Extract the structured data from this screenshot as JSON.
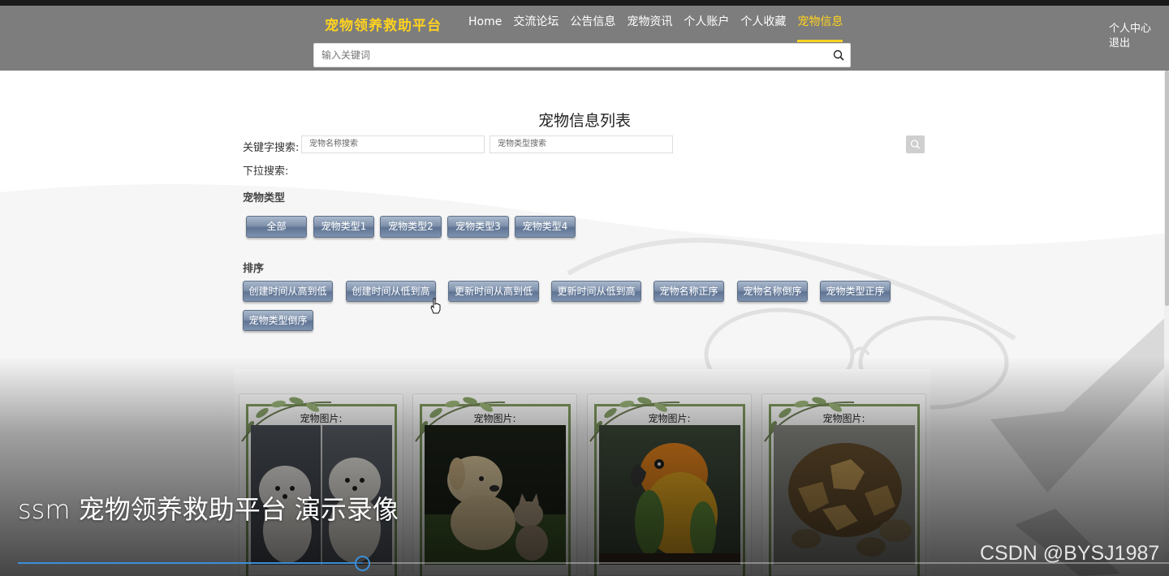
{
  "header": {
    "brand": "宠物领养救助平台",
    "nav": [
      "Home",
      "交流论坛",
      "公告信息",
      "宠物资讯",
      "个人账户",
      "个人收藏",
      "宠物信息"
    ],
    "active_nav": "宠物信息",
    "user_center": "个人中心",
    "logout": "退出",
    "search_placeholder": "输入关键词",
    "accent_color": "#ffd21f"
  },
  "main": {
    "title": "宠物信息列表",
    "keyword_label": "关键字搜索:",
    "name_search": "宠物名称搜索",
    "type_search": "宠物类型搜索",
    "dropdown_label": "下拉搜索:",
    "category_title": "宠物类型",
    "categories": [
      "全部",
      "宠物类型1",
      "宠物类型2",
      "宠物类型3",
      "宠物类型4"
    ],
    "sort_title": "排序",
    "sort_options": [
      "创建时间从高到低",
      "创建时间从低到高",
      "更新时间从高到低",
      "更新时间从低到高",
      "宠物名称正序",
      "宠物名称倒序",
      "宠物类型正序",
      "宠物类型倒序"
    ]
  },
  "cards": [
    {
      "label": "宠物图片:",
      "image": "white-pomeranian-dogs"
    },
    {
      "label": "宠物图片:",
      "image": "puppy-and-kitten"
    },
    {
      "label": "宠物图片:",
      "image": "orange-parrot"
    },
    {
      "label": "宠物图片:",
      "image": "tortoise"
    }
  ],
  "video": {
    "title": "ssm 宠物领养救助平台 演示录像",
    "progress": 0.3,
    "watermark": "CSDN @BYSJ1987",
    "progress_color": "#3b8fd9"
  }
}
